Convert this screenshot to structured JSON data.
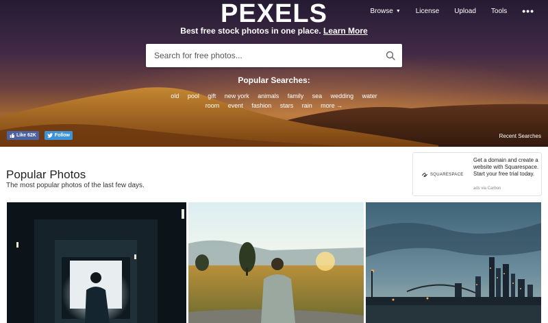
{
  "header": {
    "logo": "PEXELS",
    "nav": {
      "browse": "Browse",
      "license": "License",
      "upload": "Upload",
      "tools": "Tools",
      "more": "•••"
    },
    "tagline": "Best free stock photos in one place.",
    "tagline_link": "Learn More"
  },
  "search": {
    "placeholder": "Search for free photos..."
  },
  "popular_searches": {
    "title": "Popular Searches:",
    "row1": [
      "old",
      "pool",
      "gift",
      "new york",
      "animals",
      "family",
      "sea",
      "wedding",
      "water"
    ],
    "row2": [
      "room",
      "event",
      "fashion",
      "stars",
      "rain",
      "more →"
    ]
  },
  "social": {
    "facebook_like": "Like 62K",
    "twitter_follow": "Follow"
  },
  "recent_searches": "Recent Searches",
  "section": {
    "title": "Popular Photos",
    "subtitle": "The most popular photos of the last few days."
  },
  "ad": {
    "brand": "SQUARESPACE",
    "copy": "Get a domain and create a website with Squarespace. Start your free trial today.",
    "via": "ads via Carbon"
  },
  "colors": {
    "facebook": "#4c62a0",
    "twitter": "#3d92d8",
    "text_dark": "#222222"
  }
}
